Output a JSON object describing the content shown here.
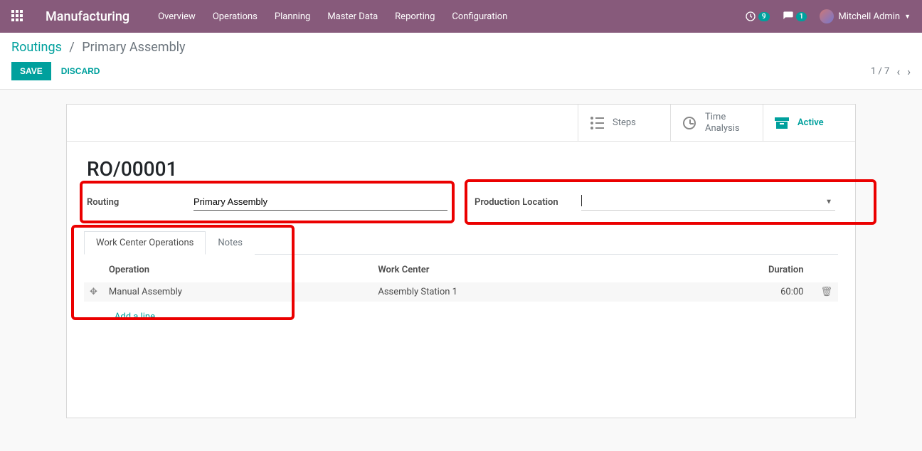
{
  "navbar": {
    "brand": "Manufacturing",
    "menu": [
      "Overview",
      "Operations",
      "Planning",
      "Master Data",
      "Reporting",
      "Configuration"
    ],
    "badge_activities": "9",
    "badge_messages": "1",
    "user_name": "Mitchell Admin"
  },
  "breadcrumb": {
    "parent": "Routings",
    "current": "Primary Assembly"
  },
  "controls": {
    "save": "SAVE",
    "discard": "DISCARD",
    "pager": "1 / 7"
  },
  "button_box": {
    "steps": "Steps",
    "time_line1": "Time",
    "time_line2": "Analysis",
    "active": "Active"
  },
  "form": {
    "title": "RO/00001",
    "routing_label": "Routing",
    "routing_value": "Primary Assembly",
    "location_label": "Production Location",
    "location_value": ""
  },
  "tabs": {
    "wc_ops": "Work Center Operations",
    "notes": "Notes"
  },
  "table": {
    "headers": {
      "operation": "Operation",
      "work_center": "Work Center",
      "duration": "Duration"
    },
    "rows": [
      {
        "operation": "Manual Assembly",
        "work_center": "Assembly Station 1",
        "duration": "60:00"
      }
    ],
    "add_line": "Add a line"
  }
}
